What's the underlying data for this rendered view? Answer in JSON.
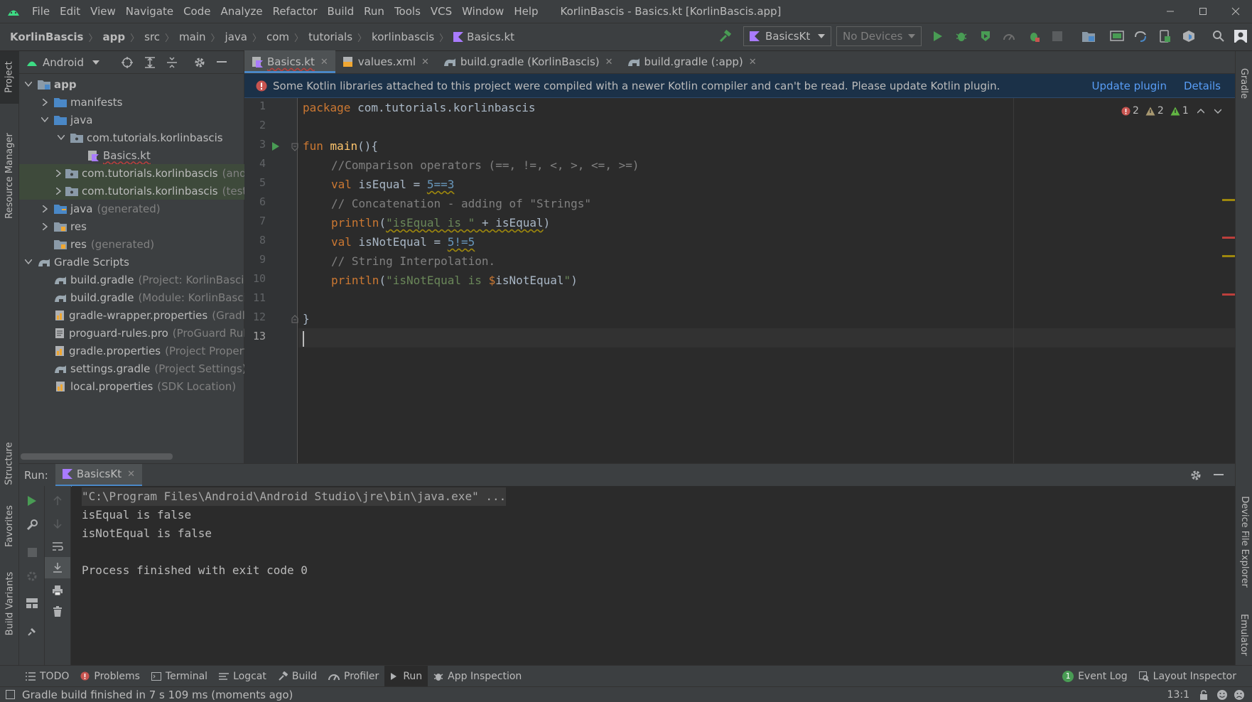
{
  "window": {
    "menu": [
      "File",
      "Edit",
      "View",
      "Navigate",
      "Code",
      "Analyze",
      "Refactor",
      "Build",
      "Run",
      "Tools",
      "VCS",
      "Window",
      "Help"
    ],
    "title": "KorlinBascis - Basics.kt [KorlinBascis.app]"
  },
  "breadcrumb": [
    "KorlinBascis",
    "app",
    "src",
    "main",
    "java",
    "com",
    "tutorials",
    "korlinbascis",
    "Basics.kt"
  ],
  "toolbar": {
    "run_config": "BasicsKt",
    "device": "No Devices"
  },
  "left_stripe": {
    "project": "Project",
    "resource_manager": "Resource Manager",
    "structure": "Structure",
    "favorites": "Favorites",
    "build_variants": "Build Variants"
  },
  "right_stripe": {
    "gradle": "Gradle",
    "device_file_explorer": "Device File Explorer",
    "emulator": "Emulator"
  },
  "project": {
    "view": "Android",
    "tree": [
      {
        "label": "app",
        "extra": ""
      },
      {
        "label": "manifests",
        "extra": ""
      },
      {
        "label": "java",
        "extra": ""
      },
      {
        "label": "com.tutorials.korlinbascis",
        "extra": ""
      },
      {
        "label": "Basics.kt",
        "extra": ""
      },
      {
        "label": "com.tutorials.korlinbascis",
        "extra": "(andro"
      },
      {
        "label": "com.tutorials.korlinbascis",
        "extra": "(test)"
      },
      {
        "label": "java",
        "extra": "(generated)"
      },
      {
        "label": "res",
        "extra": ""
      },
      {
        "label": "res",
        "extra": "(generated)"
      },
      {
        "label": "Gradle Scripts",
        "extra": ""
      },
      {
        "label": "build.gradle",
        "extra": "(Project: KorlinBascis)"
      },
      {
        "label": "build.gradle",
        "extra": "(Module: KorlinBascis.a"
      },
      {
        "label": "gradle-wrapper.properties",
        "extra": "(Gradle V"
      },
      {
        "label": "proguard-rules.pro",
        "extra": "(ProGuard Rules"
      },
      {
        "label": "gradle.properties",
        "extra": "(Project Properties"
      },
      {
        "label": "settings.gradle",
        "extra": "(Project Settings)"
      },
      {
        "label": "local.properties",
        "extra": "(SDK Location)"
      }
    ]
  },
  "tabs": [
    "Basics.kt",
    "values.xml",
    "build.gradle (KorlinBascis)",
    "build.gradle (:app)"
  ],
  "banner": {
    "message": "Some Kotlin libraries attached to this project were compiled with a newer Kotlin compiler and can't be read. Please update Kotlin plugin.",
    "update": "Update plugin",
    "details": "Details"
  },
  "inspections": {
    "errors": "2",
    "warnings": "2",
    "weak": "1"
  },
  "code": {
    "line_numbers": [
      "1",
      "2",
      "3",
      "4",
      "5",
      "6",
      "7",
      "8",
      "9",
      "10",
      "11",
      "12",
      "13"
    ],
    "l1_kw": "package",
    "l1_rest": " com.tutorials.korlinbascis",
    "l3_kw": "fun",
    "l3_fn": "main",
    "l3_rest": "(){",
    "l4": "//Comparison operators (==, !=, <, >, <=, >=)",
    "l5_kw": "val",
    "l5_name": " isEqual = ",
    "l5_expr": "5==3",
    "l6": "// Concatenation - adding of \"Strings\"",
    "l7_call": "println",
    "l7_open": "(",
    "l7_str": "\"isEqual is \"",
    "l7_plus": " + isEqual",
    ")": ")",
    "l7_close": ")",
    "l8_kw": "val",
    "l8_name": " isNotEqual = ",
    "l8_expr": "5!=5",
    "l9": "// String Interpolation.",
    "l10_call": "println",
    "l10_open": "(",
    "l10_str": "\"isNotEqual is ",
    "l10_tmpl": "$",
    "l10_var": "isNotEqual",
    "l10_end": "\"",
    "l10_close": ")",
    "l12": "}"
  },
  "run": {
    "label": "Run:",
    "tab": "BasicsKt",
    "console": [
      "\"C:\\Program Files\\Android\\Android Studio\\jre\\bin\\java.exe\" ...",
      "isEqual is false",
      "isNotEqual is false",
      "",
      "Process finished with exit code 0"
    ]
  },
  "bottom_tools": [
    "TODO",
    "Problems",
    "Terminal",
    "Logcat",
    "Build",
    "Profiler",
    "Run",
    "App Inspection"
  ],
  "bottom_right": {
    "event_log": "Event Log",
    "event_count": "1",
    "layout_inspector": "Layout Inspector"
  },
  "status": {
    "message": "Gradle build finished in 7 s 109 ms (moments ago)",
    "position": "13:1"
  },
  "colors": {
    "accent": "#4a88c7",
    "run_green": "#499c54",
    "error_red": "#c75450",
    "banner_bg": "#1b3148"
  }
}
